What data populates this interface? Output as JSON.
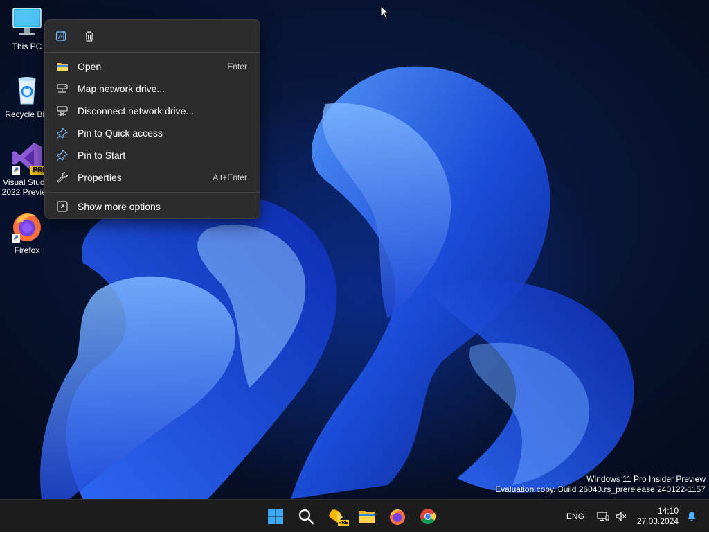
{
  "desktop": {
    "icons": [
      {
        "label": "This PC",
        "icon": "monitor-icon"
      },
      {
        "label": "Recycle Bin",
        "icon": "recycle-bin-icon"
      },
      {
        "label_line1": "Visual Studio",
        "label_line2": "2022 Preview",
        "badge": "PRE",
        "icon": "visual-studio-icon"
      },
      {
        "label": "Firefox",
        "icon": "firefox-icon"
      }
    ]
  },
  "context_menu": {
    "quick_actions": [
      {
        "icon": "rename-icon"
      },
      {
        "icon": "delete-icon"
      }
    ],
    "items": [
      {
        "label": "Open",
        "shortcut": "Enter",
        "icon": "folder-icon"
      },
      {
        "label": "Map network drive...",
        "shortcut": "",
        "icon": "network-drive-icon"
      },
      {
        "label": "Disconnect network drive...",
        "shortcut": "",
        "icon": "disconnect-drive-icon"
      },
      {
        "label": "Pin to Quick access",
        "shortcut": "",
        "icon": "pin-icon"
      },
      {
        "label": "Pin to Start",
        "shortcut": "",
        "icon": "pin-icon"
      },
      {
        "label": "Properties",
        "shortcut": "Alt+Enter",
        "icon": "wrench-icon"
      }
    ],
    "more": {
      "label": "Show more options",
      "icon": "show-more-icon"
    }
  },
  "watermark": {
    "line1": "Windows 11 Pro Insider Preview",
    "line2": "Evaluation copy. Build 26040.rs_prerelease.240122-1157"
  },
  "taskbar": {
    "apps": [
      {
        "icon": "start-icon"
      },
      {
        "icon": "search-icon"
      },
      {
        "icon": "visual-studio-preview-icon",
        "badge": "PRE"
      },
      {
        "icon": "file-explorer-icon"
      },
      {
        "icon": "firefox-icon"
      },
      {
        "icon": "chrome-icon"
      }
    ],
    "tray": {
      "language": "ENG",
      "time": "14:10",
      "date": "27.03.2024"
    }
  },
  "colors": {
    "menu_bg": "#2c2c2c",
    "taskbar_bg": "#1c1c1c",
    "accent": "#0078d4"
  }
}
